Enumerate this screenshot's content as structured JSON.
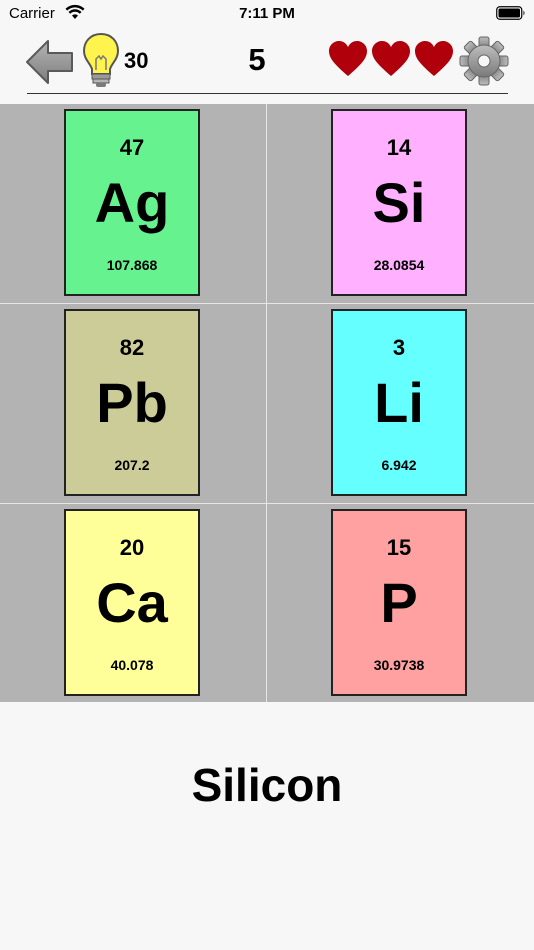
{
  "status": {
    "carrier": "Carrier",
    "time": "7:11 PM"
  },
  "toolbar": {
    "hints_remaining": "30",
    "score": "5",
    "lives": 3,
    "heart_color": "#b0000b"
  },
  "tiles": [
    {
      "number": "47",
      "symbol": "Ag",
      "mass": "107.868",
      "color": "#66f28e"
    },
    {
      "number": "14",
      "symbol": "Si",
      "mass": "28.0854",
      "color": "#ffb0ff"
    },
    {
      "number": "82",
      "symbol": "Pb",
      "mass": "207.2",
      "color": "#cccc99"
    },
    {
      "number": "3",
      "symbol": "Li",
      "mass": "6.942",
      "color": "#66ffff"
    },
    {
      "number": "20",
      "symbol": "Ca",
      "mass": "40.078",
      "color": "#ffff99"
    },
    {
      "number": "15",
      "symbol": "P",
      "mass": "30.9738",
      "color": "#ffa1a1"
    }
  ],
  "question": {
    "element_name": "Silicon"
  }
}
